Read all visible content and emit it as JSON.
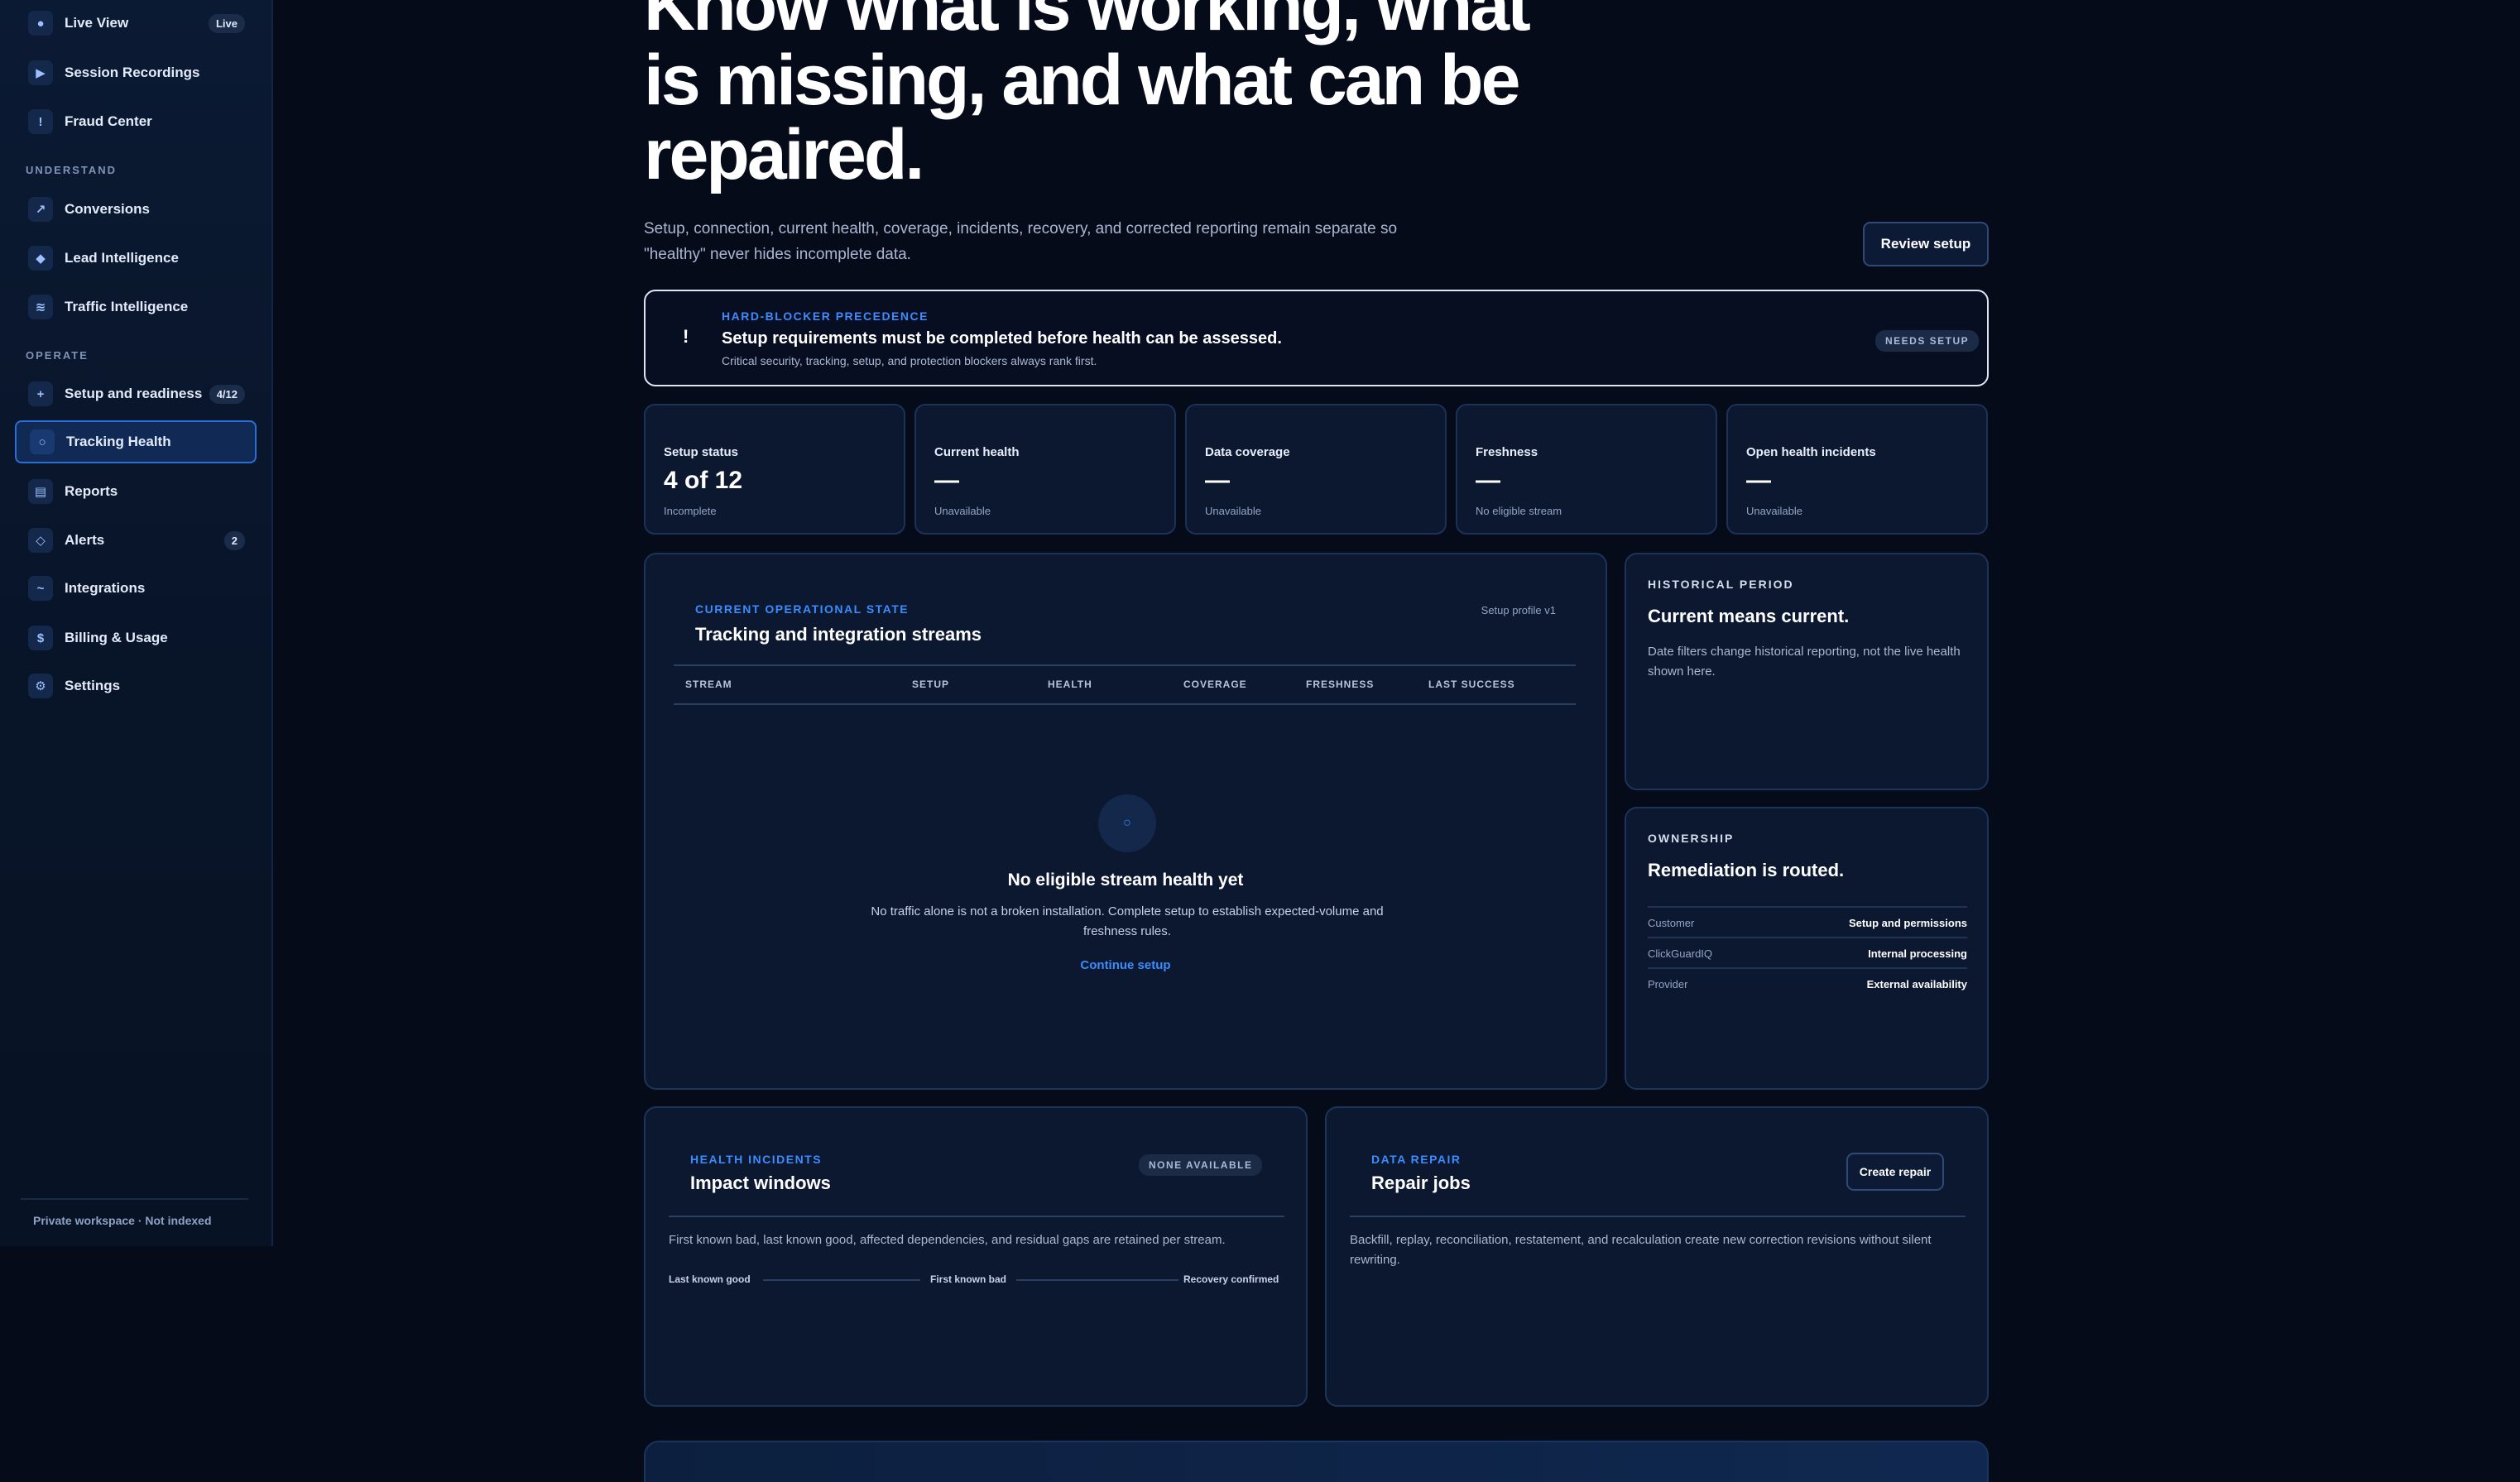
{
  "sidebar": {
    "items": [
      {
        "id": "live-view",
        "label": "Live View",
        "icon": "dot-icon",
        "glyph": "●",
        "badge": "Live"
      },
      {
        "id": "session-recordings",
        "label": "Session Recordings",
        "icon": "play-icon",
        "glyph": "▶"
      },
      {
        "id": "fraud-center",
        "label": "Fraud Center",
        "icon": "exclamation-icon",
        "glyph": "!"
      },
      {
        "id": "conversions",
        "label": "Conversions",
        "icon": "trend-arrow-icon",
        "glyph": "↗"
      },
      {
        "id": "lead-intelligence",
        "label": "Lead Intelligence",
        "icon": "diamond-icon",
        "glyph": "◆"
      },
      {
        "id": "traffic-intelligence",
        "label": "Traffic Intelligence",
        "icon": "waves-icon",
        "glyph": "≋"
      },
      {
        "id": "setup-and-readiness",
        "label": "Setup and readiness",
        "icon": "plus-icon",
        "glyph": "+",
        "badge": "4/12"
      },
      {
        "id": "tracking-health",
        "label": "Tracking Health",
        "icon": "circle-icon",
        "glyph": "○",
        "active": true
      },
      {
        "id": "reports",
        "label": "Reports",
        "icon": "report-icon",
        "glyph": "▤"
      },
      {
        "id": "alerts",
        "label": "Alerts",
        "icon": "alert-diamond-icon",
        "glyph": "◇",
        "badge": "2"
      },
      {
        "id": "integrations",
        "label": "Integrations",
        "icon": "link-icon",
        "glyph": "~"
      },
      {
        "id": "billing-usage",
        "label": "Billing & Usage",
        "icon": "dollar-icon",
        "glyph": "$"
      },
      {
        "id": "settings",
        "label": "Settings",
        "icon": "gear-icon",
        "glyph": "⚙"
      }
    ],
    "sections": {
      "understand": "UNDERSTAND",
      "operate": "OPERATE"
    },
    "footer": "Private workspace · Not indexed"
  },
  "hero": {
    "title": "Know what is working, what is missing, and what can be repaired.",
    "subtitle": "Setup, connection, current health, coverage, incidents, recovery, and corrected reporting remain separate so \"healthy\" never hides incomplete data.",
    "review_button": "Review setup"
  },
  "alert": {
    "kicker": "HARD-BLOCKER PRECEDENCE",
    "title": "Setup requirements must be completed before health can be assessed.",
    "desc": "Critical security, tracking, setup, and protection blockers always rank first.",
    "pill": "NEEDS SETUP",
    "glyph": "!"
  },
  "stats": [
    {
      "label": "Setup status",
      "value": "4 of 12",
      "sub": "Incomplete"
    },
    {
      "label": "Current health",
      "value": "—",
      "sub": "Unavailable"
    },
    {
      "label": "Data coverage",
      "value": "—",
      "sub": "Unavailable"
    },
    {
      "label": "Freshness",
      "value": "—",
      "sub": "No eligible stream"
    },
    {
      "label": "Open health incidents",
      "value": "—",
      "sub": "Unavailable"
    }
  ],
  "streams": {
    "kicker": "CURRENT OPERATIONAL STATE",
    "title": "Tracking and integration streams",
    "profile": "Setup profile v1",
    "columns": [
      "STREAM",
      "SETUP",
      "HEALTH",
      "COVERAGE",
      "FRESHNESS",
      "LAST SUCCESS"
    ],
    "empty_glyph": "○",
    "empty_title": "No eligible stream health yet",
    "empty_text": "No traffic alone is not a broken installation. Complete setup to establish expected-volume and freshness rules.",
    "empty_link": "Continue setup"
  },
  "historical": {
    "kicker": "HISTORICAL PERIOD",
    "title": "Current means current.",
    "text": "Date filters change historical reporting, not the live health shown here."
  },
  "ownership": {
    "kicker": "OWNERSHIP",
    "title": "Remediation is routed.",
    "rows": [
      {
        "who": "Customer",
        "what": "Setup and permissions"
      },
      {
        "who": "ClickGuardIQ",
        "what": "Internal processing"
      },
      {
        "who": "Provider",
        "what": "External availability"
      }
    ]
  },
  "incidents": {
    "kicker": "HEALTH INCIDENTS",
    "title": "Impact windows",
    "pill": "NONE AVAILABLE",
    "text": "First known bad, last known good, affected dependencies, and residual gaps are retained per stream.",
    "timeline": [
      "Last known good",
      "First known bad",
      "Recovery confirmed"
    ]
  },
  "repair": {
    "kicker": "DATA REPAIR",
    "title": "Repair jobs",
    "button": "Create repair",
    "text": "Backfill, replay, reconciliation, restatement, and recalculation create new correction revisions without silent rewriting."
  }
}
